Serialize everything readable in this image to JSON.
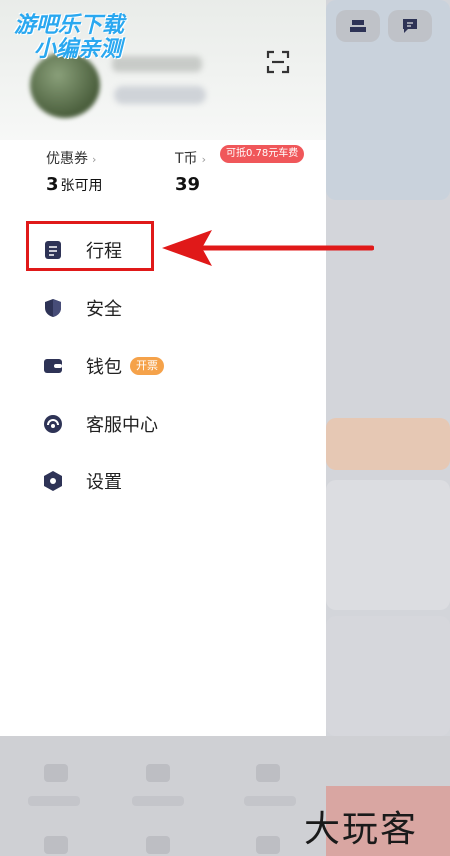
{
  "watermark": {
    "line1": "游吧乐下载",
    "line2": "小编亲测"
  },
  "stats": {
    "coupon_label": "优惠券",
    "coupon_count": "3",
    "coupon_suffix": "张可用",
    "tcoin_label": "T币",
    "tcoin_value": "39",
    "tcoin_badge": "可抵0.78元车费"
  },
  "menu": {
    "items": [
      {
        "label": "行程",
        "icon": "document-icon"
      },
      {
        "label": "安全",
        "icon": "shield-icon"
      },
      {
        "label": "钱包",
        "icon": "wallet-icon",
        "badge": "开票"
      },
      {
        "label": "客服中心",
        "icon": "headset-icon"
      },
      {
        "label": "设置",
        "icon": "gear-icon"
      }
    ]
  },
  "corner_watermark": "大玩客",
  "colors": {
    "accent_red": "#e01919",
    "badge_red": "#f0575a",
    "badge_orange": "#f5a24a",
    "watermark_blue": "#2aa8f0",
    "icon_navy": "#2e3356"
  }
}
